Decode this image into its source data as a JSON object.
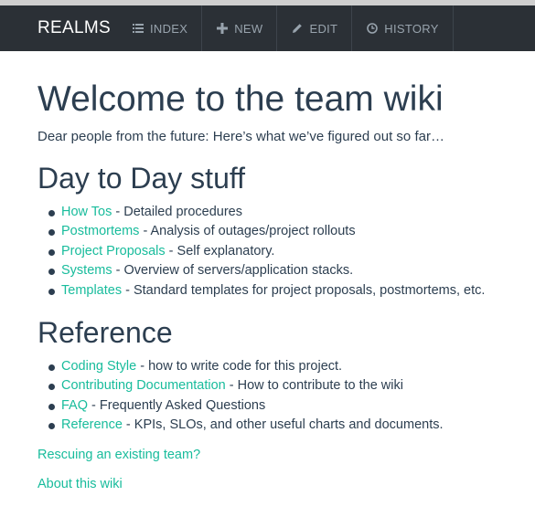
{
  "navbar": {
    "brand": "REALMS",
    "items": [
      {
        "label": "INDEX",
        "icon": "list-icon"
      },
      {
        "label": "NEW",
        "icon": "plus-icon"
      },
      {
        "label": "EDIT",
        "icon": "pencil-icon"
      },
      {
        "label": "HISTORY",
        "icon": "clock-icon"
      }
    ]
  },
  "page": {
    "title": "Welcome to the team wiki",
    "intro": "Dear people from the future: Here’s what we’ve figured out so far…",
    "sections": [
      {
        "heading": "Day to Day stuff",
        "items": [
          {
            "link": "How Tos",
            "desc": " - Detailed procedures"
          },
          {
            "link": "Postmortems",
            "desc": " - Analysis of outages/project rollouts"
          },
          {
            "link": "Project Proposals",
            "desc": " - Self explanatory."
          },
          {
            "link": "Systems",
            "desc": " - Overview of servers/application stacks."
          },
          {
            "link": "Templates",
            "desc": " - Standard templates for project proposals, postmortems, etc."
          }
        ]
      },
      {
        "heading": "Reference",
        "items": [
          {
            "link": "Coding Style",
            "desc": " - how to write code for this project."
          },
          {
            "link": "Contributing Documentation",
            "desc": " - How to contribute to the wiki"
          },
          {
            "link": "FAQ",
            "desc": " - Frequently Asked Questions"
          },
          {
            "link": "Reference",
            "desc": " - KPIs, SLOs, and other useful charts and documents."
          }
        ]
      }
    ],
    "links": [
      "Rescuing an existing team?",
      "About this wiki"
    ]
  },
  "colors": {
    "navbar_bg": "#2b3036",
    "link": "#18bc9c",
    "text": "#2c3e50"
  }
}
